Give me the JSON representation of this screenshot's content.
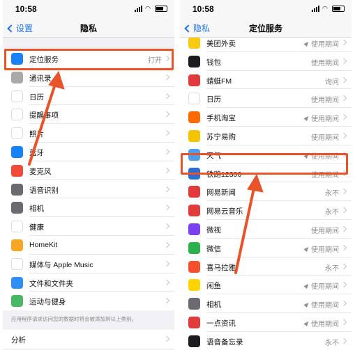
{
  "status": {
    "time": "10:58"
  },
  "left": {
    "nav": {
      "back": "设置",
      "title": "隐私"
    },
    "items": [
      {
        "label": "定位服务",
        "value": "打开",
        "icon": "location-arrow-icon",
        "color": "#1a82f7"
      },
      {
        "label": "通讯录",
        "icon": "contacts-icon",
        "color": "#a9a9a9"
      },
      {
        "label": "日历",
        "icon": "calendar-icon",
        "color": "#ffffff"
      },
      {
        "label": "提醒事项",
        "icon": "reminders-icon",
        "color": "#ffffff"
      },
      {
        "label": "照片",
        "icon": "photos-icon",
        "color": "#ffffff"
      },
      {
        "label": "蓝牙",
        "icon": "bluetooth-icon",
        "color": "#1a82f7"
      },
      {
        "label": "麦克风",
        "icon": "microphone-icon",
        "color": "#f04a3a"
      },
      {
        "label": "语音识别",
        "icon": "speech-recognition-icon",
        "color": "#6a6a70"
      },
      {
        "label": "相机",
        "icon": "camera-icon",
        "color": "#6a6a70"
      },
      {
        "label": "健康",
        "icon": "health-icon",
        "color": "#ffffff"
      },
      {
        "label": "HomeKit",
        "icon": "homekit-icon",
        "color": "#f5a623"
      },
      {
        "label": "媒体与 Apple Music",
        "icon": "music-icon",
        "color": "#ffffff"
      },
      {
        "label": "文件和文件夹",
        "icon": "folder-icon",
        "color": "#2f8ef3"
      },
      {
        "label": "运动与健身",
        "icon": "fitness-icon",
        "color": "#48b864"
      }
    ],
    "footnote": "应用程序请求访问您的数据时将会被添加到以上类别。",
    "bottom_item": "分析"
  },
  "right": {
    "nav": {
      "back": "隐私",
      "title": "定位服务"
    },
    "items": [
      {
        "label": "美团外卖",
        "value": "使用期间",
        "arrow": true,
        "icon": "meituan-icon",
        "color": "#f9c914"
      },
      {
        "label": "钱包",
        "value": "使用期间",
        "arrow": false,
        "icon": "wallet-icon",
        "color": "#1c1c1e"
      },
      {
        "label": "蜻蜓FM",
        "value": "询问",
        "arrow": false,
        "icon": "qingting-fm-icon",
        "color": "#e23b3b"
      },
      {
        "label": "日历",
        "value": "使用期间",
        "arrow": false,
        "icon": "calendar-icon",
        "color": "#ffffff"
      },
      {
        "label": "手机淘宝",
        "value": "使用期间",
        "arrow": true,
        "icon": "taobao-icon",
        "color": "#ff6a00"
      },
      {
        "label": "苏宁易购",
        "value": "使用期间",
        "arrow": false,
        "icon": "suning-icon",
        "color": "#f5c400"
      },
      {
        "label": "天气",
        "value": "使用期间",
        "arrow": true,
        "icon": "weather-icon",
        "color": "#4a9ff0"
      },
      {
        "label": "铁路12306",
        "value": "使用期间",
        "arrow": false,
        "icon": "railway-icon",
        "color": "#2d6fd1"
      },
      {
        "label": "网易新闻",
        "value": "永不",
        "arrow": false,
        "icon": "netease-news-icon",
        "color": "#e23b3b"
      },
      {
        "label": "网易云音乐",
        "value": "永不",
        "arrow": false,
        "icon": "netease-music-icon",
        "color": "#e23b3b"
      },
      {
        "label": "微视",
        "value": "使用期间",
        "arrow": false,
        "icon": "weishi-icon",
        "color": "#7b3ff2"
      },
      {
        "label": "微信",
        "value": "使用期间",
        "arrow": true,
        "icon": "wechat-icon",
        "color": "#2bb24c"
      },
      {
        "label": "喜马拉雅",
        "value": "永不",
        "arrow": false,
        "icon": "ximalaya-icon",
        "color": "#f4502d"
      },
      {
        "label": "闲鱼",
        "value": "使用期间",
        "arrow": true,
        "icon": "xianyu-icon",
        "color": "#ffd400"
      },
      {
        "label": "相机",
        "value": "使用期间",
        "arrow": true,
        "icon": "camera-icon",
        "color": "#6a6a70"
      },
      {
        "label": "一点资讯",
        "value": "使用期间",
        "arrow": true,
        "icon": "yidian-icon",
        "color": "#e23b3b"
      },
      {
        "label": "语音备忘录",
        "value": "永不",
        "arrow": false,
        "icon": "voice-memos-icon",
        "color": "#1c1c1e"
      }
    ]
  },
  "colors": {
    "accent": "#1a73e8",
    "highlight": "#e8532a"
  }
}
